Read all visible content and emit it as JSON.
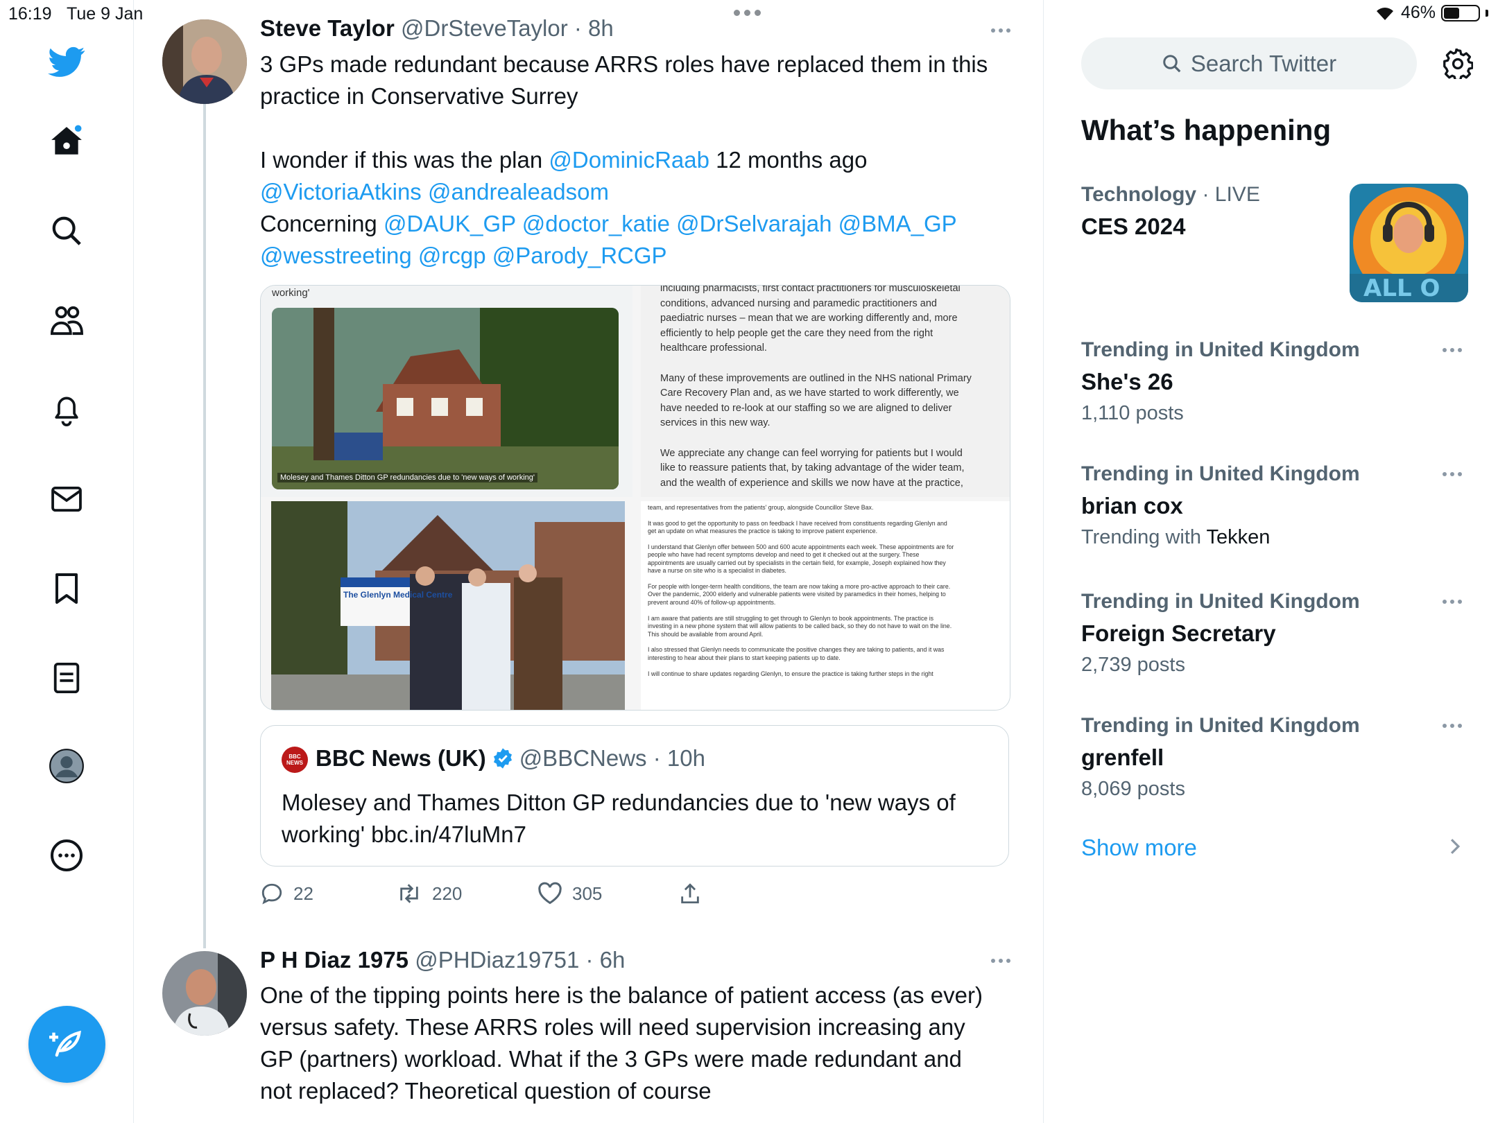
{
  "status": {
    "time": "16:19",
    "date": "Tue 9 Jan",
    "battery": "46%",
    "battery_level": 0.46
  },
  "nav": {
    "items": [
      "home",
      "explore",
      "communities",
      "notifications",
      "messages",
      "bookmarks",
      "lists",
      "profile",
      "more"
    ]
  },
  "tweet1": {
    "name": "Steve Taylor",
    "handle": "@DrSteveTaylor · 8h",
    "line1": "3 GPs made redundant because ARRS roles have replaced them in this",
    "line2": "practice in Conservative Surrey",
    "line3_pre": "I wonder if this was the plan ",
    "mention_raab": "@DominicRaab",
    "line3_post": " 12 months ago",
    "line4": "@VictoriaAtkins @andrealeadsom",
    "concerning": "Concerning ",
    "line5_mentions": "@DAUK_GP @doctor_katie @DrSelvarajah @BMA_GP",
    "line6": "@wesstreeting @rcgp @Parody_RCGP",
    "media": {
      "caption_top": "working'",
      "photo_caption": "Molesey and Thames Ditton GP redundancies due to 'new ways of working'",
      "sign_text": "The Glenlyn Medical Centre",
      "doc1": [
        "including pharmacists, first contact practitioners for musculoskeletal",
        "conditions, advanced nursing and paramedic practitioners and",
        "paediatric nurses – mean that we are working differently and, more",
        "efficiently to help people get the care they need from the right",
        "healthcare professional.",
        "",
        "Many of these improvements are outlined in the NHS national Primary",
        "Care Recovery Plan and, as we have started to work differently, we",
        "have needed to re-look at our staffing so we are aligned to deliver",
        "services in this new way.",
        "",
        "We appreciate any change can feel worrying for patients but I would",
        "like to reassure patients that, by taking advantage of the wider team,",
        "and the wealth of experience and skills we now have at the practice,"
      ],
      "doc2": [
        "team, and representatives from the patients' group, alongside Councillor Steve Bax.",
        "",
        "It was good to get the opportunity to pass on feedback I have received from constituents regarding Glenlyn and",
        "get an update on what measures the practice is taking to improve patient experience.",
        "",
        "I understand that Glenlyn offer between 500 and 600 acute appointments each week. These appointments are for",
        "people who have had recent symptoms develop and need to get it checked out at the surgery. These",
        "appointments are usually carried out by specialists in the certain field, for example, Joseph explained how they",
        "have a nurse on site who is a specialist in diabetes.",
        "",
        "For people with longer-term health conditions, the team are now taking a more pro-active approach to their care.",
        "Over the pandemic, 2000 elderly and vulnerable patients were visited by paramedics in their homes, helping to",
        "prevent around 40% of follow-up appointments.",
        "",
        "I am aware that patients are still struggling to get through to Glenlyn to book appointments. The practice is",
        "investing in a new phone system that will allow patients to be called back, so they do not have to wait on the line.",
        "This should be available from around April.",
        "",
        "I also stressed that Glenlyn needs to communicate the positive changes they are taking to patients, and it was",
        "interesting to hear about their plans to start keeping patients up to date.",
        "",
        "I will continue to share updates regarding Glenlyn, to ensure the practice is taking further steps in the right"
      ]
    },
    "quote": {
      "name": "BBC News (UK)",
      "handle": "@BBCNews · 10h",
      "logo": "BBC NEWS",
      "text1": "Molesey and Thames Ditton GP redundancies due to 'new ways of",
      "text2": "working' bbc.in/47luMn7"
    },
    "replies": "22",
    "retweets": "220",
    "likes": "305"
  },
  "tweet2": {
    "name": "P H Diaz 1975",
    "handle": "@PHDiaz19751 · 6h",
    "lines": [
      "One of the tipping points here is the balance of patient access (as ever)",
      "versus safety. These ARRS roles will need supervision increasing any",
      "GP (partners) workload. What if the 3 GPs were made redundant and",
      "not replaced? Theoretical question of course"
    ]
  },
  "sidebar": {
    "search_placeholder": "Search Twitter",
    "heading": "What’s happening",
    "featured": {
      "category": "Technology",
      "live": " · LIVE",
      "title": "CES 2024"
    },
    "trends": [
      {
        "category": "Trending in United Kingdom",
        "name": "She's 26",
        "meta": "1,110 posts"
      },
      {
        "category": "Trending in United Kingdom",
        "name": "brian cox",
        "meta_pre": "Trending with ",
        "meta_strong": "Tekken"
      },
      {
        "category": "Trending in United Kingdom",
        "name": "Foreign Secretary",
        "meta": "2,739 posts"
      },
      {
        "category": "Trending in United Kingdom",
        "name": "grenfell",
        "meta": "8,069 posts"
      }
    ],
    "show_more": "Show more"
  },
  "colors": {
    "accent": "#1d9bf0",
    "muted": "#536471",
    "border": "#cfd9de"
  }
}
